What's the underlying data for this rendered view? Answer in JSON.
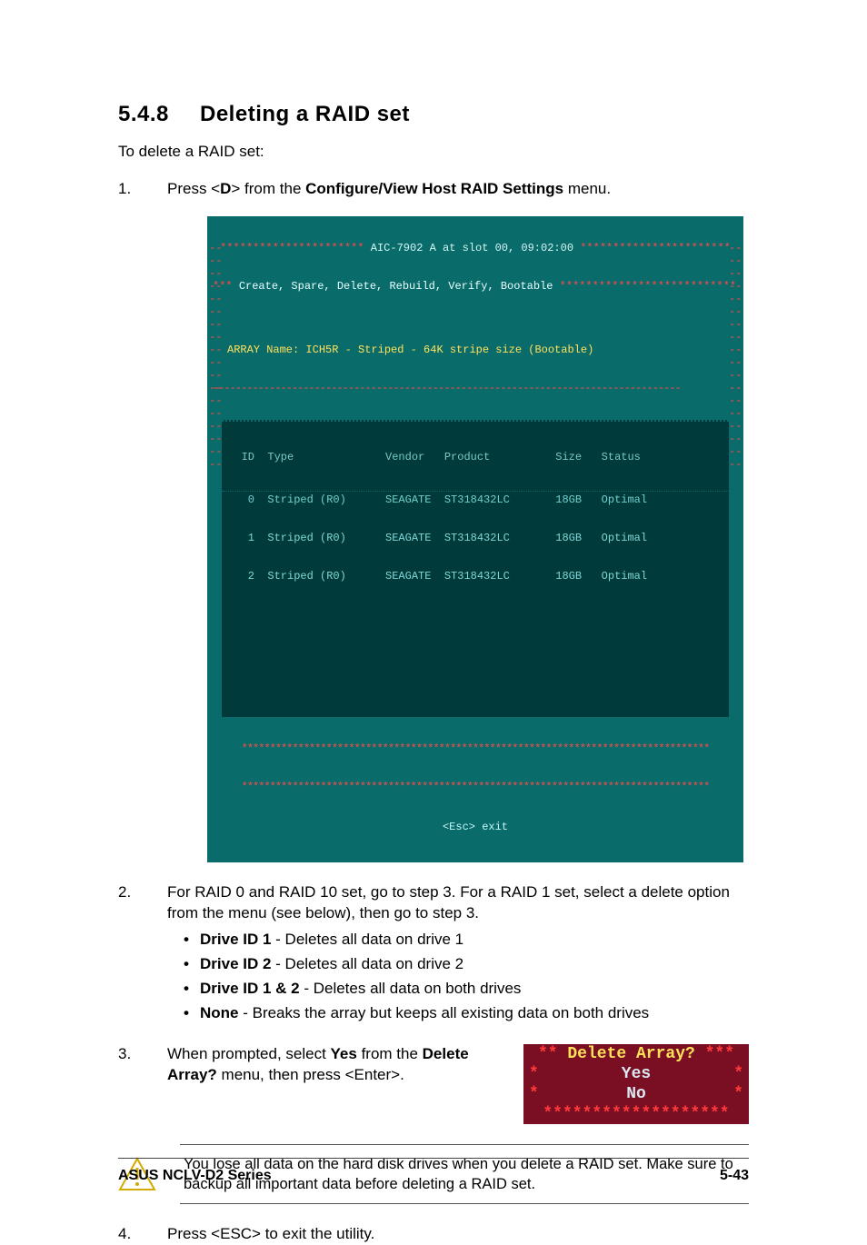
{
  "heading": {
    "number": "5.4.8",
    "title": "Deleting a RAID set"
  },
  "intro": "To delete a RAID set:",
  "step1": {
    "prefix": "Press <",
    "key": "D",
    "mid": "> from the ",
    "menu": "Configure/View Host RAID Settings",
    "suffix": " menu."
  },
  "terminal": {
    "title_line": " AIC-7902 A at slot 00, 09:02:00 ",
    "menu_line_pre": "*** ",
    "menu_items": "Create, Spare, Delete, Rebuild, Verify, Bootable",
    "menu_line_post": " ",
    "array_line": "ARRAY Name: ICH5R - Striped - 64K stripe size (Bootable)",
    "header": "   ID  Type              Vendor   Product          Size   Status",
    "rows": [
      "    0  Striped (R0)      SEAGATE  ST318432LC       18GB   Optimal",
      "    1  Striped (R0)      SEAGATE  ST318432LC       18GB   Optimal",
      "    2  Striped (R0)      SEAGATE  ST318432LC       18GB   Optimal"
    ],
    "footer": "<Esc> exit"
  },
  "step2": {
    "text": "For RAID 0 and RAID 10 set, go to step 3. For a RAID 1 set, select a delete option from the menu (see below), then go to step 3.",
    "opts": [
      {
        "label": "Drive ID 1",
        "desc": " - Deletes all data on drive 1"
      },
      {
        "label": "Drive ID 2",
        "desc": " - Deletes all data on drive 2"
      },
      {
        "label": "Drive ID 1 & 2",
        "desc": " - Deletes all data on both drives"
      },
      {
        "label": "None",
        "desc": "  - Breaks the array but keeps all existing data on both drives"
      }
    ]
  },
  "step3": {
    "pre": "When prompted, select ",
    "yes": "Yes",
    "mid": " from the ",
    "menu": "Delete Array?",
    "post": " menu, then press <Enter>."
  },
  "delete_prompt": {
    "title": "Delete Array?",
    "opt_yes": "Yes",
    "opt_no": "No"
  },
  "note": "You lose all data on the hard disk drives when you delete a RAID set. Make sure to backup all important data before deleting a RAID set.",
  "step4": "Press <ESC> to exit the utility.",
  "footer": {
    "series": "ASUS NCLV-D2 Series",
    "page": "5-43"
  }
}
